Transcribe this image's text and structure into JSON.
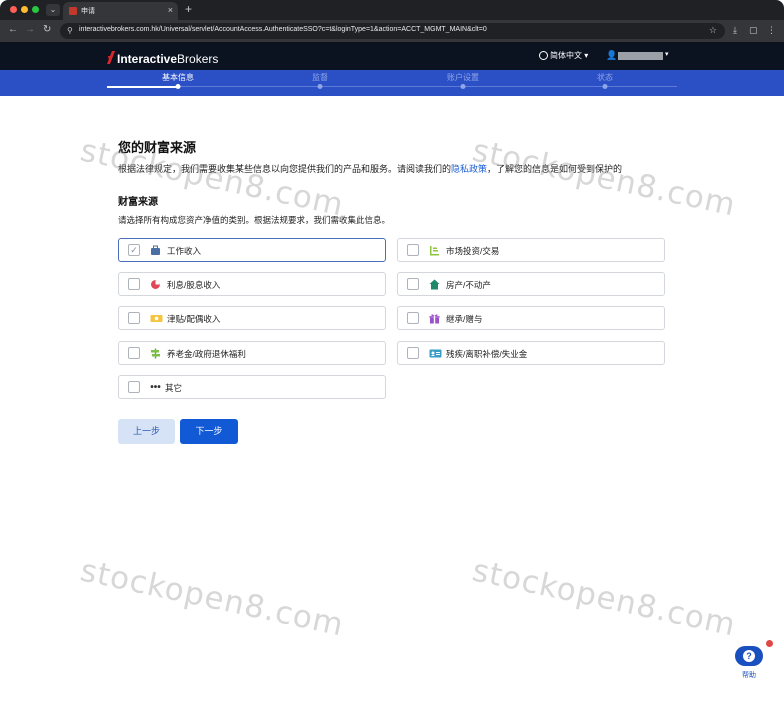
{
  "browser": {
    "tab_title": "申请",
    "tab_close": "×",
    "new_tab": "+",
    "url": "interactivebrokers.com.hk/Universal/servlet/AccountAccess.AuthenticateSSO?c=t&loginType=1&action=ACCT_MGMT_MAIN&clt=0"
  },
  "header": {
    "logo_bold": "Interactive",
    "logo_rest": "Brokers",
    "language": "简体中文",
    "logo_color": "#d9262b"
  },
  "steps": [
    {
      "label": "基本信息",
      "active": true
    },
    {
      "label": "监督",
      "active": false
    },
    {
      "label": "账户设置",
      "active": false
    },
    {
      "label": "状态",
      "active": false
    }
  ],
  "page": {
    "title": "您的财富来源",
    "intro_before": "根据法律规定，我们需要收集某些信息以向您提供我们的产品和服务。请阅读我们的",
    "intro_link": "隐私政策",
    "intro_after": "，了解您的信息是如何受到保护的",
    "section_title": "财富来源",
    "section_desc": "请选择所有构成您资产净值的类别。根据法规要求，我们需收集此信息。"
  },
  "options": [
    {
      "label": "工作收入",
      "icon": "briefcase-icon",
      "checked": true
    },
    {
      "label": "市场投资/交易",
      "icon": "bar-chart-icon",
      "checked": false
    },
    {
      "label": "利息/股息收入",
      "icon": "pie-chart-icon",
      "checked": false
    },
    {
      "label": "房产/不动产",
      "icon": "house-icon",
      "checked": false
    },
    {
      "label": "津贴/配偶收入",
      "icon": "allowance-icon",
      "checked": false
    },
    {
      "label": "继承/赠与",
      "icon": "gift-icon",
      "checked": false
    },
    {
      "label": "养老金/政府退休福利",
      "icon": "pension-icon",
      "checked": false
    },
    {
      "label": "残疾/离职补偿/失业金",
      "icon": "id-card-icon",
      "checked": false
    },
    {
      "label": "其它",
      "icon": "more-dots-icon",
      "checked": false
    }
  ],
  "buttons": {
    "prev": "上一步",
    "next": "下一步"
  },
  "help": {
    "label": "帮助"
  },
  "watermark": "stockopen8.com"
}
